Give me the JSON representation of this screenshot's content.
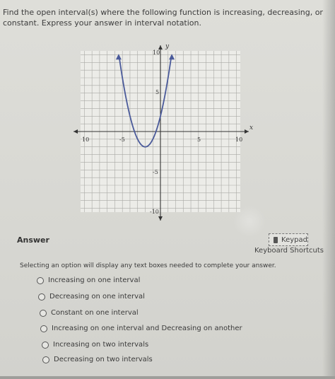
{
  "question": {
    "text": "Find the open interval(s) where the following function is increasing, decreasing, or constant. Express your answer in interval notation."
  },
  "graph": {
    "x_axis_label": "x",
    "y_axis_label": "y",
    "ticks": {
      "x_neg10": "10",
      "x_neg5": "-5",
      "x_5": "5",
      "x_10": "10",
      "y_10": "10",
      "y_5": "5",
      "y_neg5": "-5",
      "y_neg10": "-10"
    },
    "curve_color": "#4a5a9a"
  },
  "answer": {
    "label": "Answer",
    "keypad_label": "Keypad",
    "shortcuts_label": "Keyboard Shortcuts",
    "help_text": "Selecting an option will display any text boxes needed to complete your answer."
  },
  "options": [
    "Increasing on one interval",
    "Decreasing on one interval",
    "Constant on one interval",
    "Increasing on one interval and Decreasing on another",
    "Increasing on two intervals",
    "Decreasing on two intervals"
  ]
}
